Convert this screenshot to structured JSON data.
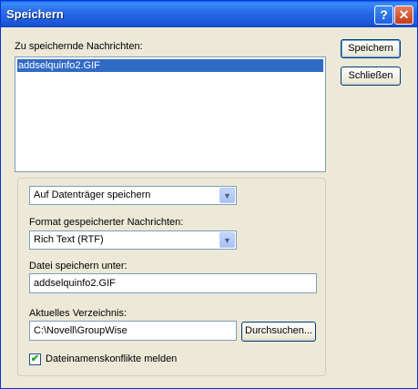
{
  "window": {
    "title": "Speichern"
  },
  "titlebar_buttons": {
    "help": "?",
    "close": "✕"
  },
  "messages": {
    "label": "Zu speichernde Nachrichten:",
    "items": [
      "addselquinfo2.GIF"
    ]
  },
  "buttons": {
    "save": "Speichern",
    "close": "Schließen",
    "browse": "Durchsuchen..."
  },
  "destination": {
    "value": "Auf Datenträger speichern"
  },
  "format": {
    "label": "Format gespeicherter Nachrichten:",
    "value": "Rich Text (RTF)"
  },
  "filename": {
    "label": "Datei speichern unter:",
    "value": "addselquinfo2.GIF"
  },
  "directory": {
    "label": "Aktuelles Verzeichnis:",
    "value": "C:\\Novell\\GroupWise"
  },
  "conflicts": {
    "label": "Dateinamenskonflikte melden",
    "checked": true,
    "check_glyph": "✔"
  },
  "icons": {
    "dropdown_arrow": "▼"
  }
}
